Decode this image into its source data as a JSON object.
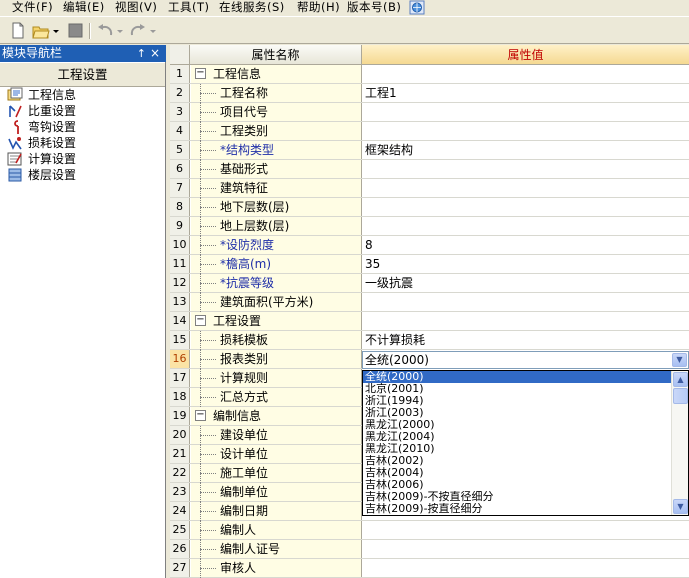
{
  "menubar": {
    "items": [
      "文件(F)",
      "编辑(E)",
      "视图(V)",
      "工具(T)",
      "在线服务(S)",
      "帮助(H)",
      "版本号(B)"
    ],
    "app_icon": "update-globe-icon"
  },
  "toolbar": {
    "buttons": [
      "new-file-icon",
      "open-folder-icon",
      "save-icon",
      "undo-icon",
      "redo-icon"
    ]
  },
  "nav": {
    "title": "模块导航栏",
    "pin_icon": "pin-icon",
    "close_icon": "close-icon",
    "header": "工程设置",
    "items": [
      {
        "label": "工程信息",
        "icon": "project-info-icon"
      },
      {
        "label": "比重设置",
        "icon": "weight-icon"
      },
      {
        "label": "弯钩设置",
        "icon": "hook-icon"
      },
      {
        "label": "损耗设置",
        "icon": "loss-icon"
      },
      {
        "label": "计算设置",
        "icon": "calc-icon"
      },
      {
        "label": "楼层设置",
        "icon": "floor-icon"
      }
    ]
  },
  "grid": {
    "col_name_header": "属性名称",
    "col_value_header": "属性值",
    "rows": [
      {
        "num": "1",
        "name": "工程信息",
        "value": "",
        "type": "group",
        "required": false
      },
      {
        "num": "2",
        "name": "工程名称",
        "value": "工程1",
        "type": "child",
        "required": false
      },
      {
        "num": "3",
        "name": "项目代号",
        "value": "",
        "type": "child",
        "required": false
      },
      {
        "num": "4",
        "name": "工程类别",
        "value": "",
        "type": "child",
        "required": false
      },
      {
        "num": "5",
        "name": "*结构类型",
        "value": "框架结构",
        "type": "child",
        "required": true
      },
      {
        "num": "6",
        "name": "基础形式",
        "value": "",
        "type": "child",
        "required": false
      },
      {
        "num": "7",
        "name": "建筑特征",
        "value": "",
        "type": "child",
        "required": false
      },
      {
        "num": "8",
        "name": "地下层数(层)",
        "value": "",
        "type": "child",
        "required": false
      },
      {
        "num": "9",
        "name": "地上层数(层)",
        "value": "",
        "type": "child",
        "required": false
      },
      {
        "num": "10",
        "name": "*设防烈度",
        "value": "8",
        "type": "child",
        "required": true
      },
      {
        "num": "11",
        "name": "*檐高(m)",
        "value": "35",
        "type": "child",
        "required": true
      },
      {
        "num": "12",
        "name": "*抗震等级",
        "value": "一级抗震",
        "type": "child",
        "required": true
      },
      {
        "num": "13",
        "name": "建筑面积(平方米)",
        "value": "",
        "type": "child",
        "required": false
      },
      {
        "num": "14",
        "name": "工程设置",
        "value": "",
        "type": "group",
        "required": false
      },
      {
        "num": "15",
        "name": "损耗模板",
        "value": "不计算损耗",
        "type": "child",
        "required": false
      },
      {
        "num": "16",
        "name": "报表类别",
        "value": "",
        "type": "child",
        "required": false
      },
      {
        "num": "17",
        "name": "计算规则",
        "value": "",
        "type": "child",
        "required": false
      },
      {
        "num": "18",
        "name": "汇总方式",
        "value": "",
        "type": "child",
        "required": false
      },
      {
        "num": "19",
        "name": "编制信息",
        "value": "",
        "type": "group",
        "required": false
      },
      {
        "num": "20",
        "name": "建设单位",
        "value": "",
        "type": "child",
        "required": false
      },
      {
        "num": "21",
        "name": "设计单位",
        "value": "",
        "type": "child",
        "required": false
      },
      {
        "num": "22",
        "name": "施工单位",
        "value": "",
        "type": "child",
        "required": false
      },
      {
        "num": "23",
        "name": "编制单位",
        "value": "",
        "type": "child",
        "required": false
      },
      {
        "num": "24",
        "name": "编制日期",
        "value": "",
        "type": "child",
        "required": false
      },
      {
        "num": "25",
        "name": "编制人",
        "value": "",
        "type": "child",
        "required": false
      },
      {
        "num": "26",
        "name": "编制人证号",
        "value": "",
        "type": "child",
        "required": false
      },
      {
        "num": "27",
        "name": "审核人",
        "value": "",
        "type": "child",
        "required": false
      }
    ]
  },
  "combo": {
    "value": "全统(2000)",
    "button_icon": "chevron-down-icon"
  },
  "dropdown": {
    "options": [
      "全统(2000)",
      "北京(2001)",
      "浙江(1994)",
      "浙江(2003)",
      "黑龙江(2000)",
      "黑龙江(2004)",
      "黑龙江(2010)",
      "吉林(2002)",
      "吉林(2004)",
      "吉林(2006)",
      "吉林(2009)-不按直径细分",
      "吉林(2009)-按直径细分"
    ],
    "selected_index": 0
  }
}
